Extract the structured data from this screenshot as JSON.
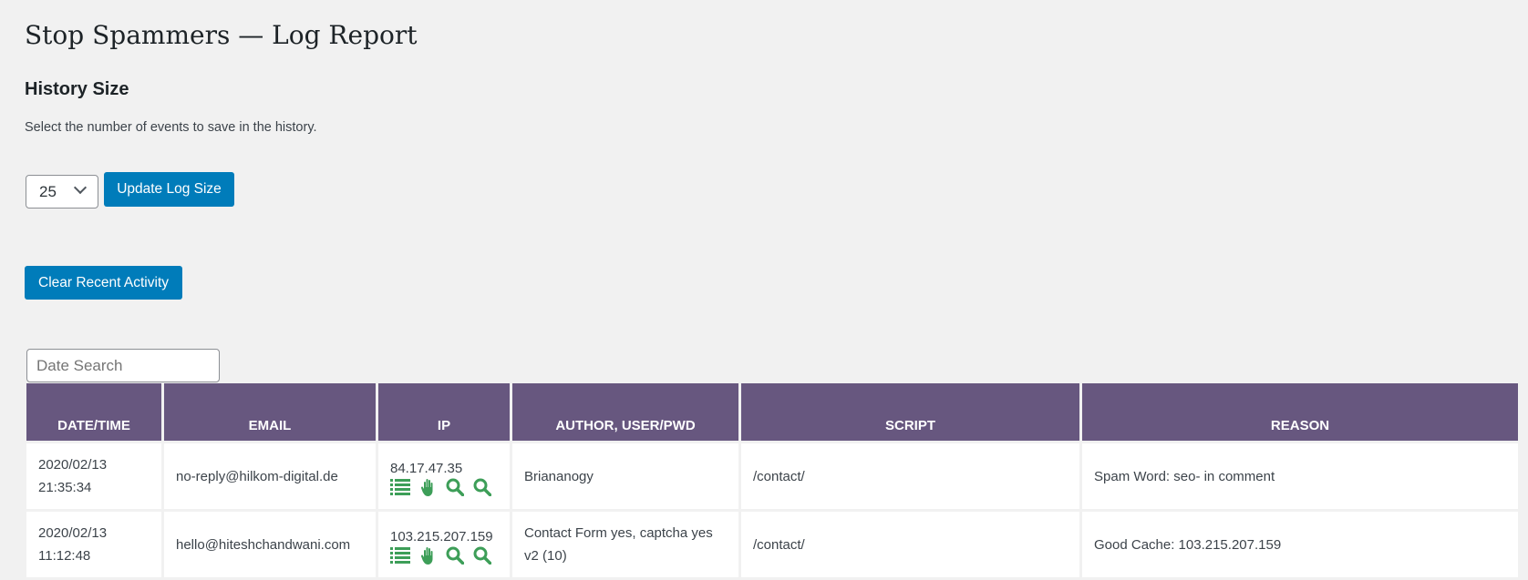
{
  "page_title": "Stop Spammers — Log Report",
  "history": {
    "heading": "History Size",
    "description": "Select the number of events to save in the history.",
    "selected_size": "25",
    "update_label": "Update Log Size"
  },
  "clear_label": "Clear Recent Activity",
  "date_search": {
    "placeholder": "Date Search",
    "value": ""
  },
  "colors": {
    "header": "#67577f",
    "button": "#007cba",
    "icon": "#3d9e58"
  },
  "table": {
    "columns": [
      "DATE/TIME",
      "EMAIL",
      "IP",
      "AUTHOR, USER/PWD",
      "SCRIPT",
      "REASON"
    ],
    "rows": [
      {
        "date": "2020/02/13",
        "time": "21:35:34",
        "email": "no-reply@hilkom-digital.de",
        "ip": "84.17.47.35",
        "author": "Briananogy",
        "script": "/contact/",
        "reason": "Spam Word: seo- in comment"
      },
      {
        "date": "2020/02/13",
        "time": "11:12:48",
        "email": "hello@hiteshchandwani.com",
        "ip": "103.215.207.159",
        "author": "Contact Form yes, captcha yes v2 (10)",
        "script": "/contact/",
        "reason": "Good Cache: 103.215.207.159"
      }
    ]
  },
  "ip_icons": [
    "list-icon",
    "hand-stop-icon",
    "search-icon",
    "search-icon"
  ]
}
